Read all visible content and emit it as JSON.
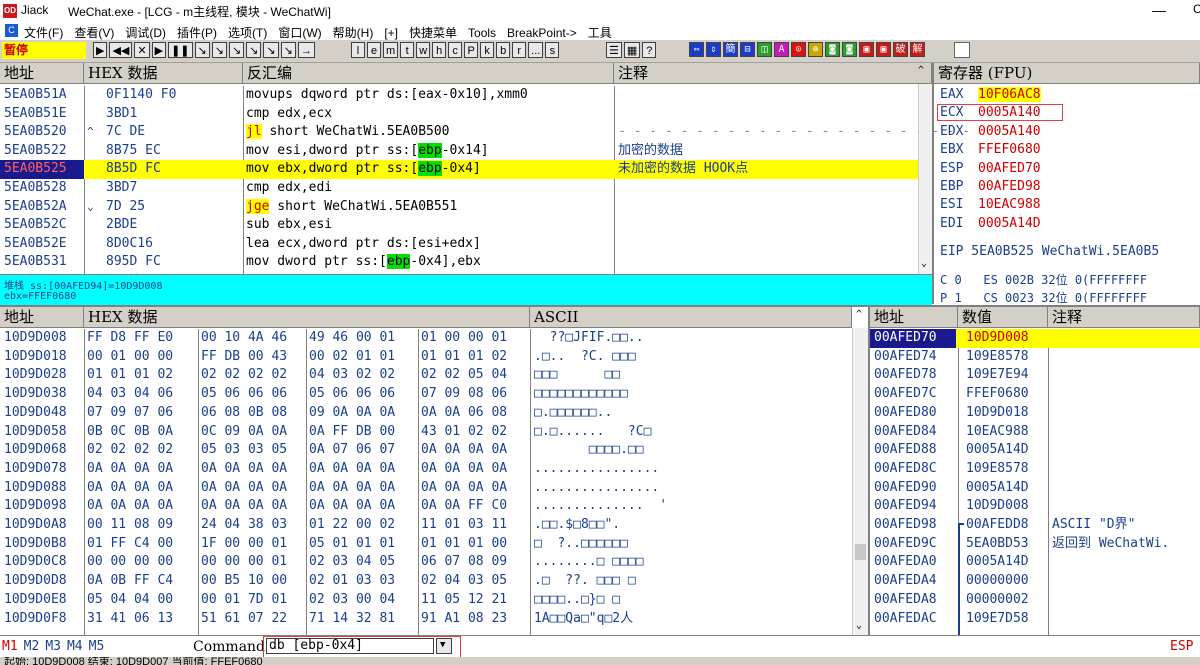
{
  "title": {
    "app_icon": "OD",
    "app": "Jiack",
    "text": "WeChat.exe - [LCG - m主线程, 模块 - WeChatWi]",
    "minimize": "—",
    "maximize": "C"
  },
  "menu": {
    "icon": "C",
    "items": [
      "文件(F)",
      "查看(V)",
      "调试(D)",
      "插件(P)",
      "选项(T)",
      "窗口(W)",
      "帮助(H)",
      "[+]",
      "快捷菜单",
      "Tools",
      "BreakPoint->",
      "工具"
    ]
  },
  "toolbar": {
    "status": "暂停",
    "nav_buttons": [
      "▶",
      "◀◀",
      "✕",
      "▶",
      "❚❚",
      "↘",
      "↘",
      "↘",
      "↘",
      "↘",
      "↘",
      "→"
    ],
    "letter_buttons": [
      "l",
      "e",
      "m",
      "t",
      "w",
      "h",
      "c",
      "P",
      "k",
      "b",
      "r",
      "...",
      "s"
    ],
    "misc_buttons": [
      "☰",
      "▦",
      "?"
    ],
    "plugin_colors": [
      "#1a3cc8",
      "#1a3cc8",
      "#1a3cc8",
      "#1a3cc8",
      "#2aa02a",
      "#c81ab4",
      "#e01010",
      "#c8a800",
      "#2aa02a",
      "#2aa02a",
      "#c81a1a",
      "#c81a1a",
      "#c81a1a",
      "#c81a1a"
    ],
    "plugin_labels": [
      "⇔",
      "⇕",
      "簡",
      "⊟",
      "◫",
      "A",
      "⊙",
      "⊚",
      "◙",
      "◙",
      "▣",
      "▣",
      "破",
      "解"
    ]
  },
  "cpu": {
    "headers": {
      "addr": "地址",
      "hex": "HEX 数据",
      "disasm": "反汇编",
      "comment": "注释"
    },
    "rows": [
      {
        "addr": "5EA0B51A",
        "mark": "",
        "hex": "0F1140 F0",
        "pre": "movups dqword ptr ds:[eax-0x10],xmm0",
        "hl": "",
        "post": "",
        "comment": ""
      },
      {
        "addr": "5EA0B51E",
        "mark": "",
        "hex": "3BD1",
        "pre": "cmp edx,ecx",
        "hl": "",
        "post": "",
        "comment": ""
      },
      {
        "addr": "5EA0B520",
        "mark": "^",
        "hex": "7C DE",
        "pre": "",
        "jmp": "jl",
        "post": " short WeChatWi.5EA0B500",
        "comment": "- - - - - - - - - - - - - - - - - - - - - - -"
      },
      {
        "addr": "5EA0B522",
        "mark": "",
        "hex": "8B75 EC",
        "pre": "mov esi,dword ptr ss:[",
        "hl": "ebp",
        "post": "-0x14]",
        "comment": "加密的数据"
      },
      {
        "addr": "5EA0B525",
        "mark": "",
        "hex": "8B5D FC",
        "pre": "mov ebx,dword ptr ss:[",
        "hl": "ebp",
        "post": "-0x4]",
        "comment": "未加密的数据 HOOK点"
      },
      {
        "addr": "5EA0B528",
        "mark": "",
        "hex": "3BD7",
        "pre": "cmp edx,edi",
        "hl": "",
        "post": "",
        "comment": ""
      },
      {
        "addr": "5EA0B52A",
        "mark": "⌄",
        "hex": "7D 25",
        "pre": "",
        "jmp": "jge",
        "post": " short WeChatWi.5EA0B551",
        "comment": ""
      },
      {
        "addr": "5EA0B52C",
        "mark": "",
        "hex": "2BDE",
        "pre": "sub ebx,esi",
        "hl": "",
        "post": "",
        "comment": ""
      },
      {
        "addr": "5EA0B52E",
        "mark": "",
        "hex": "8D0C16",
        "pre": "lea ecx,dword ptr ds:[esi+edx]",
        "hl": "",
        "post": "",
        "comment": ""
      },
      {
        "addr": "5EA0B531",
        "mark": "",
        "hex": "895D FC",
        "pre": "mov dword ptr ss:[",
        "hl": "ebp",
        "post": "-0x4],ebx",
        "comment": ""
      }
    ],
    "selected_index": 4,
    "info_line1": "堆栈 ss:[00AFED94]=10D9D008",
    "info_line2": "ebx=FFEF0680"
  },
  "registers": {
    "header": "寄存器 (FPU)",
    "rows": [
      {
        "name": "EAX",
        "value": "10F06AC8"
      },
      {
        "name": "ECX",
        "value": "0005A140"
      },
      {
        "name": "EDX",
        "value": "0005A140"
      },
      {
        "name": "EBX",
        "value": "FFEF0680"
      },
      {
        "name": "ESP",
        "value": "00AFED70"
      },
      {
        "name": "EBP",
        "value": "00AFED98"
      },
      {
        "name": "ESI",
        "value": "10EAC988"
      },
      {
        "name": "EDI",
        "value": "0005A14D"
      }
    ],
    "eip": "EIP 5EA0B525 WeChatWi.5EA0B5",
    "flags1": "C 0   ES 002B 32位 0(FFFFFFFF",
    "flags2": "P 1   CS 0023 32位 0(FFFFFFFF"
  },
  "dump": {
    "headers": {
      "addr": "地址",
      "hex": "HEX 数据",
      "ascii": "ASCII"
    },
    "rows": [
      {
        "addr": "10D9D008",
        "hex": [
          "FF D8 FF E0",
          "00 10 4A 46",
          "49 46 00 01",
          "01 00 00 01"
        ],
        "ascii": "  ??□JFIF.□□.."
      },
      {
        "addr": "10D9D018",
        "hex": [
          "00 01 00 00",
          "FF DB 00 43",
          "00 02 01 01",
          "01 01 01 02"
        ],
        "ascii": ".□..  ?C. □□□"
      },
      {
        "addr": "10D9D028",
        "hex": [
          "01 01 01 02",
          "02 02 02 02",
          "04 03 02 02",
          "02 02 05 04"
        ],
        "ascii": "□□□      □□ "
      },
      {
        "addr": "10D9D038",
        "hex": [
          "04 03 04 06",
          "05 06 06 06",
          "05 06 06 06",
          "07 09 08 06"
        ],
        "ascii": "□□□□□□□□□□□□"
      },
      {
        "addr": "10D9D048",
        "hex": [
          "07 09 07 06",
          "06 08 0B 08",
          "09 0A 0A 0A",
          "0A 0A 06 08"
        ],
        "ascii": "□.□□□□□□.."
      },
      {
        "addr": "10D9D058",
        "hex": [
          "0B 0C 0B 0A",
          "0C 09 0A 0A",
          "0A FF DB 00",
          "43 01 02 02"
        ],
        "ascii": "□.□......   ?C□"
      },
      {
        "addr": "10D9D068",
        "hex": [
          "02 02 02 02",
          "05 03 03 05",
          "0A 07 06 07",
          "0A 0A 0A 0A"
        ],
        "ascii": "       □□□□.□□"
      },
      {
        "addr": "10D9D078",
        "hex": [
          "0A 0A 0A 0A",
          "0A 0A 0A 0A",
          "0A 0A 0A 0A",
          "0A 0A 0A 0A"
        ],
        "ascii": "................"
      },
      {
        "addr": "10D9D088",
        "hex": [
          "0A 0A 0A 0A",
          "0A 0A 0A 0A",
          "0A 0A 0A 0A",
          "0A 0A 0A 0A"
        ],
        "ascii": "................"
      },
      {
        "addr": "10D9D098",
        "hex": [
          "0A 0A 0A 0A",
          "0A 0A 0A 0A",
          "0A 0A 0A 0A",
          "0A 0A FF C0"
        ],
        "ascii": "..............  '"
      },
      {
        "addr": "10D9D0A8",
        "hex": [
          "00 11 08 09",
          "24 04 38 03",
          "01 22 00 02",
          "11 01 03 11"
        ],
        "ascii": ".□□.$□8□□\"."
      },
      {
        "addr": "10D9D0B8",
        "hex": [
          "01 FF C4 00",
          "1F 00 00 01",
          "05 01 01 01",
          "01 01 01 00"
        ],
        "ascii": "□  ?..□□□□□□"
      },
      {
        "addr": "10D9D0C8",
        "hex": [
          "00 00 00 00",
          "00 00 00 01",
          "02 03 04 05",
          "06 07 08 09"
        ],
        "ascii": "........□ □□□□"
      },
      {
        "addr": "10D9D0D8",
        "hex": [
          "0A 0B FF C4",
          "00 B5 10 00",
          "02 01 03 03",
          "02 04 03 05"
        ],
        "ascii": ".□  ??. □□□ □"
      },
      {
        "addr": "10D9D0E8",
        "hex": [
          "05 04 04 00",
          "00 01 7D 01",
          "02 03 00 04",
          "11 05 12 21"
        ],
        "ascii": "□□□□..□}□ □"
      },
      {
        "addr": "10D9D0F8",
        "hex": [
          "31 41 06 13",
          "51 61 07 22",
          "71 14 32 81",
          "91 A1 08 23"
        ],
        "ascii": "1A□□Qa□\"q□2人"
      }
    ]
  },
  "stack": {
    "headers": {
      "addr": "地址",
      "value": "数值",
      "comment": "注释"
    },
    "rows": [
      {
        "addr": "00AFED70",
        "value": "10D9D008",
        "comment": ""
      },
      {
        "addr": "00AFED74",
        "value": "109E8578",
        "comment": ""
      },
      {
        "addr": "00AFED78",
        "value": "109E7E94",
        "comment": ""
      },
      {
        "addr": "00AFED7C",
        "value": "FFEF0680",
        "comment": ""
      },
      {
        "addr": "00AFED80",
        "value": "10D9D018",
        "comment": ""
      },
      {
        "addr": "00AFED84",
        "value": "10EAC988",
        "comment": ""
      },
      {
        "addr": "00AFED88",
        "value": "0005A14D",
        "comment": ""
      },
      {
        "addr": "00AFED8C",
        "value": "109E8578",
        "comment": ""
      },
      {
        "addr": "00AFED90",
        "value": "0005A14D",
        "comment": ""
      },
      {
        "addr": "00AFED94",
        "value": "10D9D008",
        "comment": ""
      },
      {
        "addr": "00AFED98",
        "value": "00AFEDD8",
        "comment": "ASCII \"D界\""
      },
      {
        "addr": "00AFED9C",
        "value": "5EA0BD53",
        "comment": "返回到 WeChatWi."
      },
      {
        "addr": "00AFEDA0",
        "value": "0005A14D",
        "comment": ""
      },
      {
        "addr": "00AFEDA4",
        "value": "00000000",
        "comment": ""
      },
      {
        "addr": "00AFEDA8",
        "value": "00000002",
        "comment": ""
      },
      {
        "addr": "00AFEDAC",
        "value": "109E7D58",
        "comment": ""
      }
    ]
  },
  "command": {
    "marks": [
      "M1",
      "M2",
      "M3",
      "M4",
      "M5"
    ],
    "label": "Command:",
    "value": "db [ebp-0x4]",
    "right": "ESP"
  },
  "statusbar": {
    "text": "起始: 10D9D008  结束: 10D9D007  当前值: FFEF0680"
  }
}
